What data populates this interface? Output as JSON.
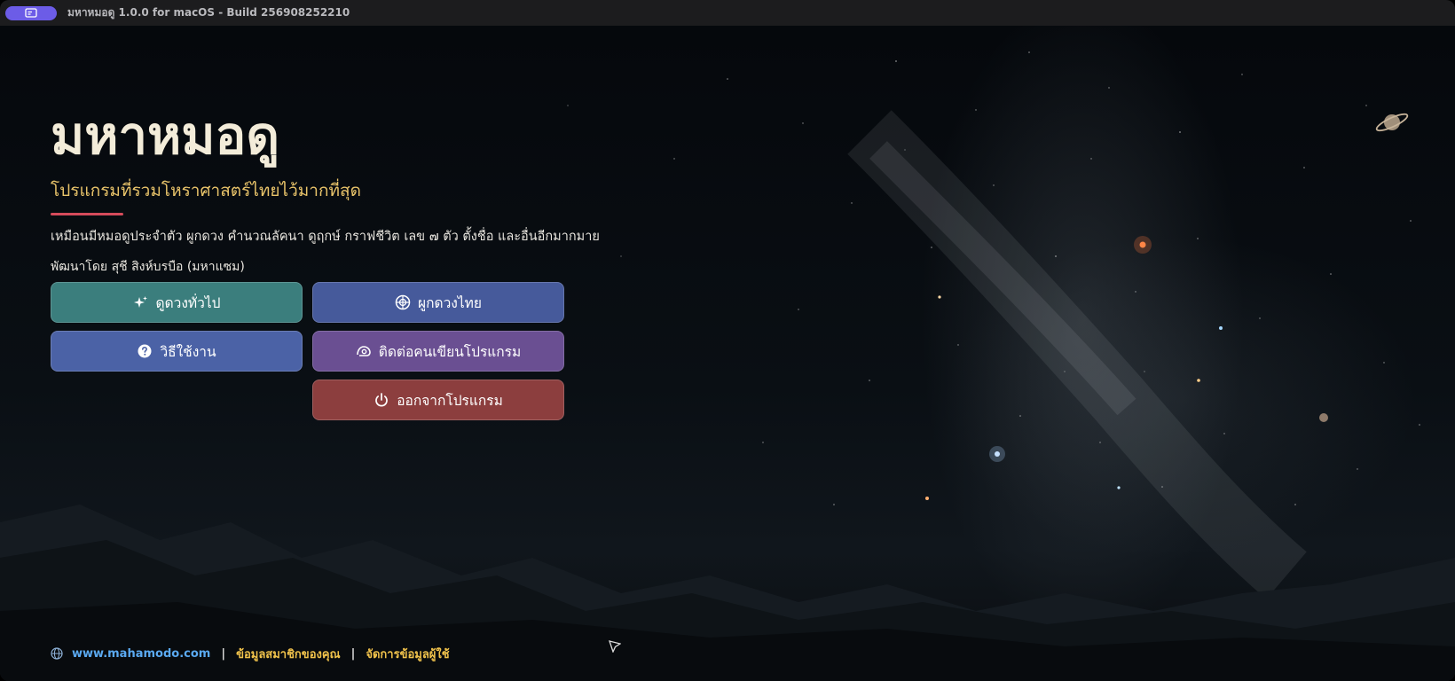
{
  "titlebar": {
    "title": "มหาหมอดู 1.0.0 for macOS - Build 256908252210",
    "app_icon": "app-window-icon",
    "accent_color": "#6c5ce7"
  },
  "hero": {
    "title": "มหาหมอดู",
    "subtitle": "โปรแกรมที่รวมโหราศาสตร์ไทยไว้มากที่สุด",
    "description": "เหมือนมีหมอดูประจำตัว ผูกดวง คำนวณลัคนา ดูฤกษ์ กราฟชีวิต เลข ๗ ตัว ตั้งชื่อ และอื่นอีกมากมาย",
    "developer": "พัฒนาโดย  สุชี สิงห์บรบือ (มหาแซม)"
  },
  "buttons": {
    "general": {
      "label": "ดูดวงทั่วไป",
      "icon": "sparkle-icon",
      "color": "#3b7e7d"
    },
    "thai": {
      "label": "ผูกดวงไทย",
      "icon": "zodiac-wheel-icon",
      "color": "#465a9b"
    },
    "howto": {
      "label": "วิธีใช้งาน",
      "icon": "help-circle-icon",
      "color": "#4b62a6"
    },
    "contact": {
      "label": "ติดต่อคนเขียนโปรแกรม",
      "icon": "contact-icon",
      "color": "#6a4f92"
    },
    "exit": {
      "label": "ออกจากโปรแกรม",
      "icon": "power-icon",
      "color": "#8c3e3e"
    }
  },
  "footer": {
    "website": "www.mahamodo.com",
    "separator": "|",
    "member_info": "ข้อมูลสมาชิกของคุณ",
    "manage_users": "จัดการข้อมูลผู้ใช้"
  }
}
